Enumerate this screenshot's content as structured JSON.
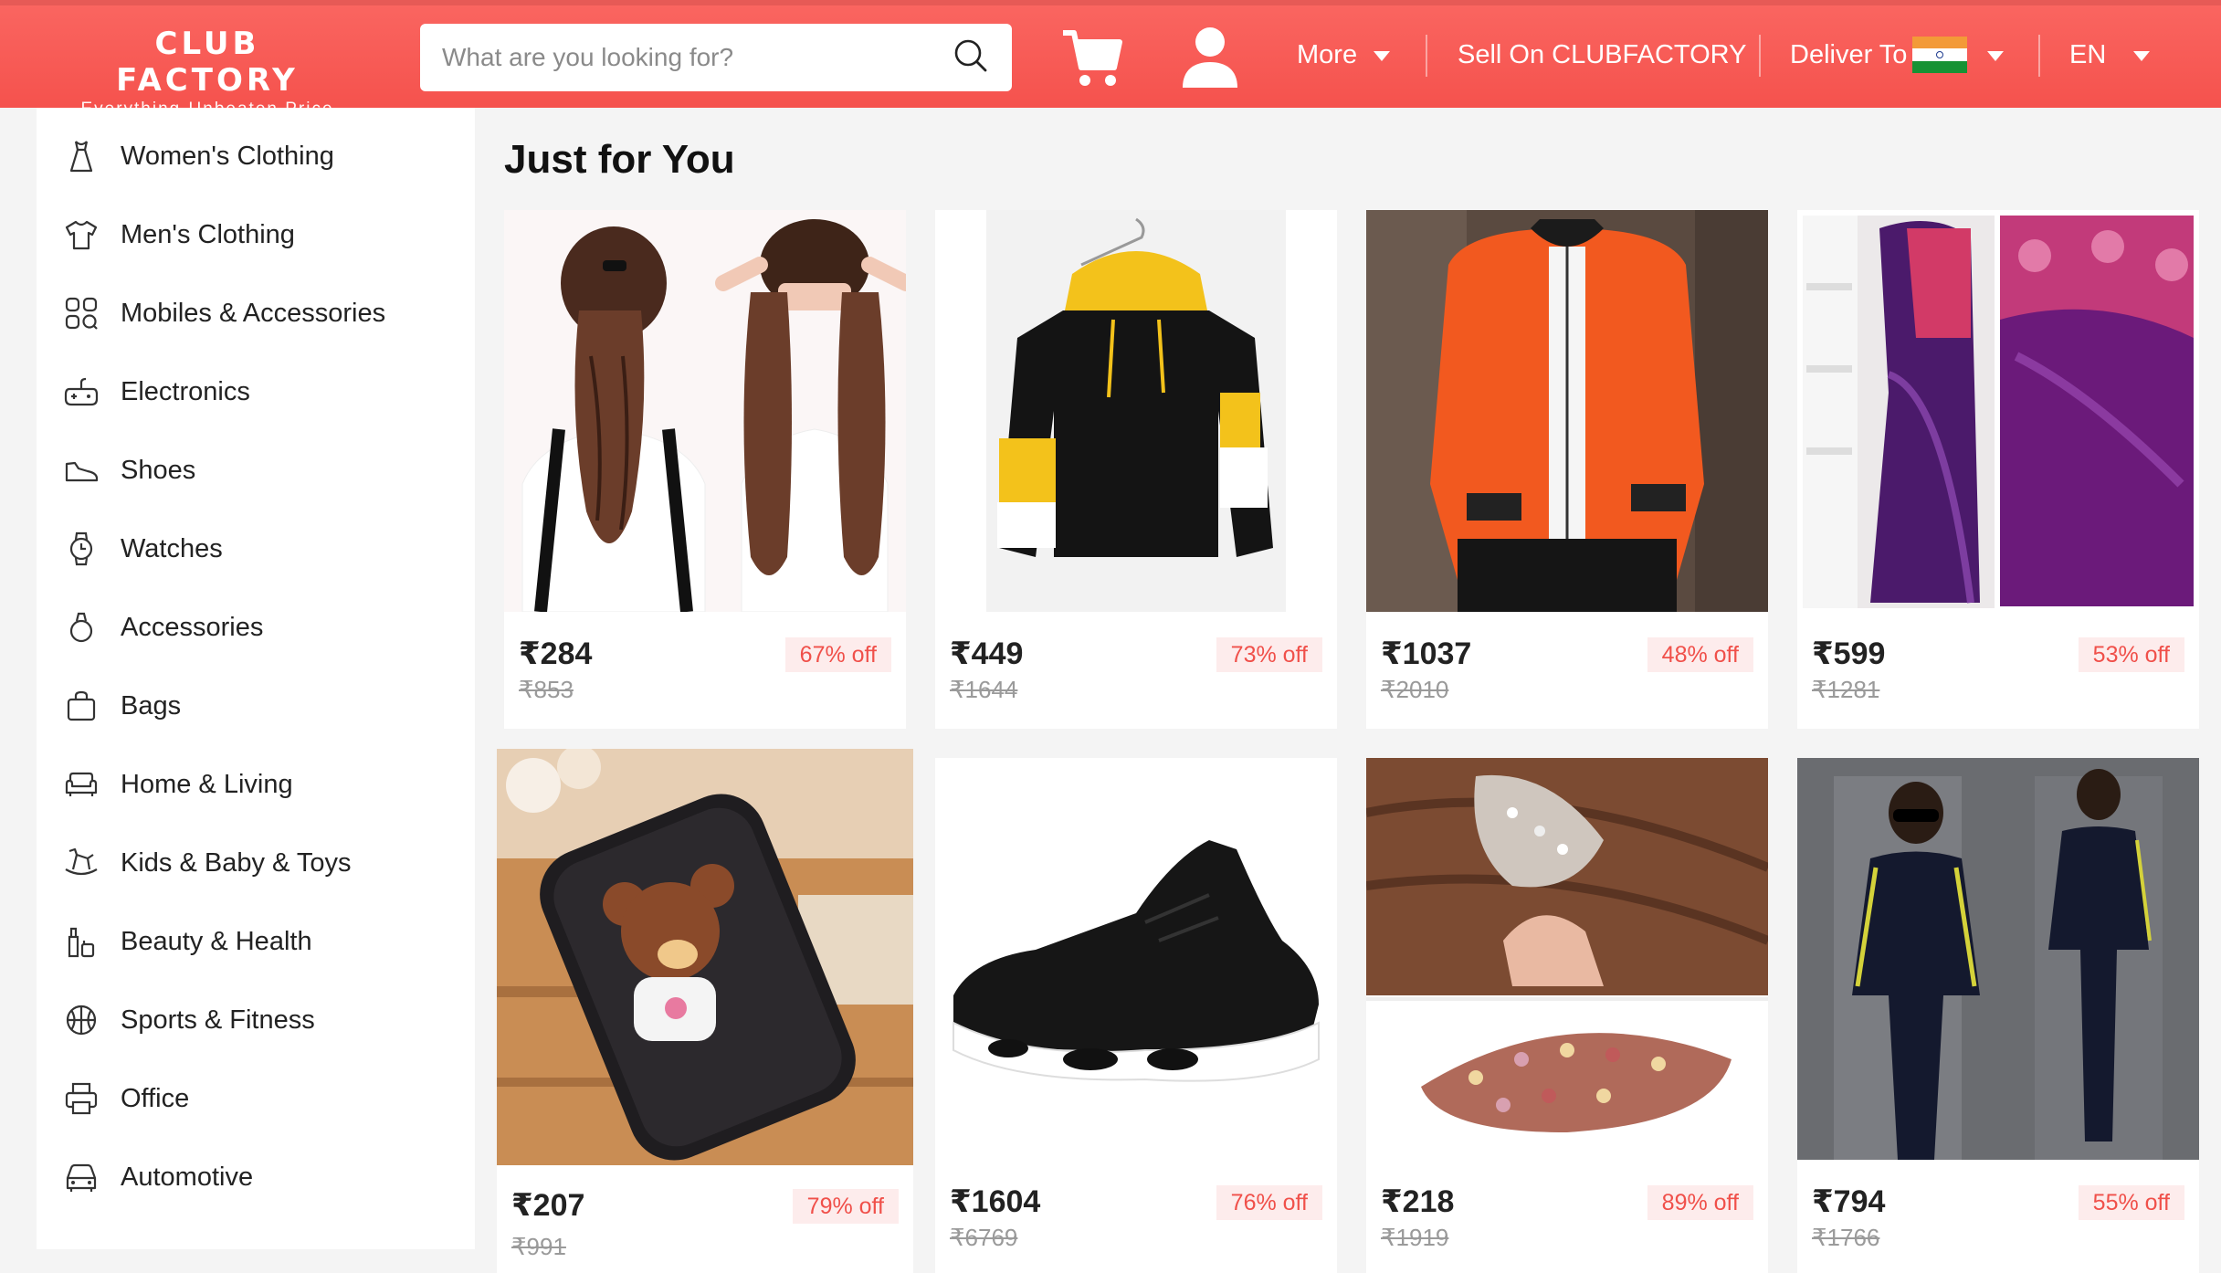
{
  "header": {
    "logo_title": "CLUB FACTORY",
    "logo_subtitle": "Everything·Unbeaten Price",
    "search_placeholder": "What are you looking for?",
    "more_label": "More",
    "sell_label": "Sell On CLUBFACTORY",
    "deliver_label": "Deliver To",
    "language_label": "EN",
    "brand_color": "#f85e58"
  },
  "sidebar": {
    "items": [
      {
        "label": "Women's Clothing",
        "icon": "dress-icon"
      },
      {
        "label": "Men's Clothing",
        "icon": "tshirt-icon"
      },
      {
        "label": "Mobiles & Accessories",
        "icon": "apps-grid-icon"
      },
      {
        "label": "Electronics",
        "icon": "gamepad-icon"
      },
      {
        "label": "Shoes",
        "icon": "shoe-icon"
      },
      {
        "label": "Watches",
        "icon": "watch-icon"
      },
      {
        "label": "Accessories",
        "icon": "ring-icon"
      },
      {
        "label": "Bags",
        "icon": "bag-icon"
      },
      {
        "label": "Home & Living",
        "icon": "sofa-icon"
      },
      {
        "label": "Kids & Baby & Toys",
        "icon": "rocking-horse-icon"
      },
      {
        "label": "Beauty & Health",
        "icon": "cosmetics-icon"
      },
      {
        "label": "Sports & Fitness",
        "icon": "basketball-icon"
      },
      {
        "label": "Office",
        "icon": "printer-icon"
      },
      {
        "label": "Automotive",
        "icon": "car-icon"
      }
    ]
  },
  "main": {
    "section_title": "Just for You",
    "products": [
      {
        "price": "₹284",
        "original_price": "₹853",
        "discount": "67% off",
        "image": "hair-ponytail-extension"
      },
      {
        "price": "₹449",
        "original_price": "₹1644",
        "discount": "73% off",
        "image": "black-yellow-hoodie"
      },
      {
        "price": "₹1037",
        "original_price": "₹2010",
        "discount": "48% off",
        "image": "orange-bomber-jacket"
      },
      {
        "price": "₹599",
        "original_price": "₹1281",
        "discount": "53% off",
        "image": "purple-saree"
      },
      {
        "price": "₹207",
        "original_price": "₹991",
        "discount": "79% off",
        "image": "teddy-bear-zipper-case"
      },
      {
        "price": "₹1604",
        "original_price": "₹6769",
        "discount": "76% off",
        "image": "black-sneaker"
      },
      {
        "price": "₹218",
        "original_price": "₹1919",
        "discount": "89% off",
        "image": "crystal-hair-clip"
      },
      {
        "price": "₹794",
        "original_price": "₹1766",
        "discount": "55% off",
        "image": "navy-tracksuit"
      }
    ]
  }
}
